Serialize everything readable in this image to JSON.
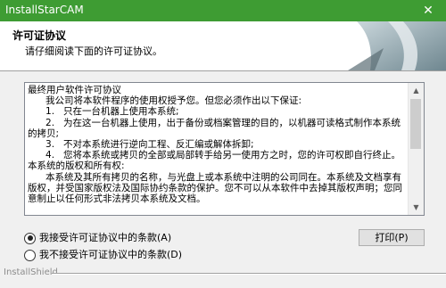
{
  "window": {
    "title": "InstallStarCAM",
    "close_glyph": "✕"
  },
  "header": {
    "title": "许可证协议",
    "subtitle": "请仔细阅读下面的许可证协议。"
  },
  "license": {
    "lines": [
      "最终用户软件许可协议",
      "      我公司将本软件程序的使用权授予您。但您必须作出以下保证:",
      "      1.   只在一台机器上使用本系统;",
      "      2.   为在这一台机器上使用，出于备份或档案管理的目的，以机器可读格式制作本系统的拷贝;",
      "      3.   不对本系统进行逆向工程、反汇编或解体拆卸;",
      "      4.   您将本系统或拷贝的全部或局部转手给另一使用方之时，您的许可权即自行终止。",
      "本系统的版权和所有权:",
      "      本系统及其所有拷贝的名称，与光盘上或本系统中注明的公司同在。本系统及文档享有版权，并受国家版权法及国际协约条款的保护。您不可以从本软件中去掉其版权声明；您同意制止以任何形式非法拷贝本系统及文档。"
    ]
  },
  "options": {
    "accept": "我接受许可证协议中的条款(A)",
    "decline": "我不接受许可证协议中的条款(D)",
    "selected": "accept"
  },
  "print_button": "打印(P)",
  "brand": "InstallShield"
}
